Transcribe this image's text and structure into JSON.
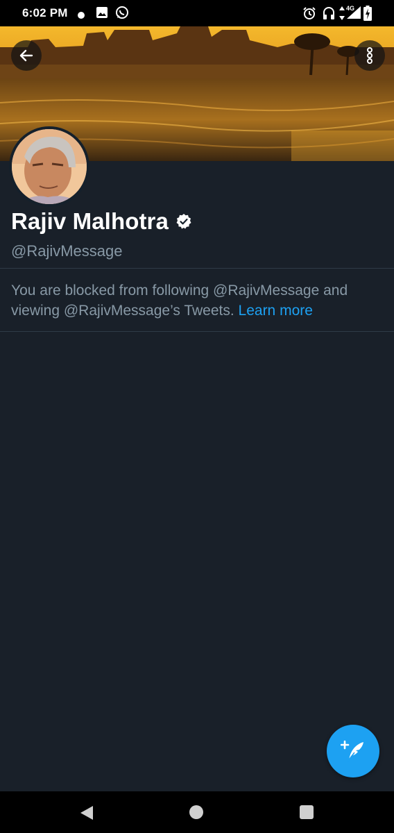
{
  "status_bar": {
    "time": "6:02 PM",
    "network": "4G",
    "icons": [
      "notification-dot-icon",
      "gallery-icon",
      "whatsapp-icon",
      "alarm-icon",
      "headphones-icon",
      "data-arrows-icon",
      "signal-icon",
      "battery-charging-icon"
    ]
  },
  "header": {
    "back_icon": "arrow-left-icon",
    "more_icon": "more-vertical-icon"
  },
  "profile": {
    "name": "Rajiv Malhotra",
    "verified": true,
    "handle": "@RajivMessage"
  },
  "blocked_notice": {
    "text": "You are blocked from following @RajivMessage and viewing @RajivMessage’s Tweets.",
    "link": "Learn more"
  },
  "fab": {
    "icon": "compose-tweet-icon"
  },
  "nav_bar": {
    "icons": [
      "back-triangle-icon",
      "home-circle-icon",
      "recents-square-icon"
    ]
  },
  "colors": {
    "background": "#15202b",
    "accent": "#1da1f2",
    "secondary_text": "#8899a6",
    "divider": "#2f3b47"
  }
}
